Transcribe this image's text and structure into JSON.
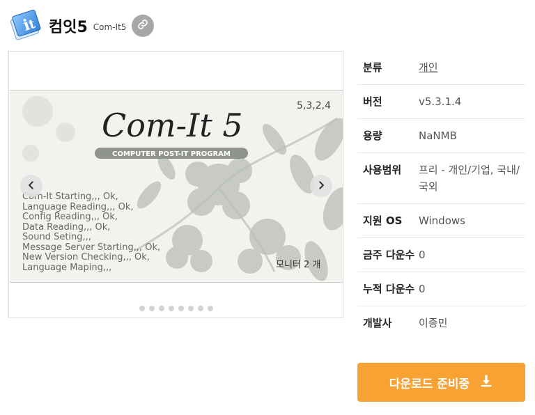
{
  "app": {
    "title": "컴잇5",
    "subtitle": "Com-It5"
  },
  "screenshot": {
    "logo": "Com-It 5",
    "version_tag": "5,3,2,4",
    "banner": "COMPUTER POST-IT PROGRAM",
    "log_lines": [
      "Com-It Starting,,, Ok,",
      "Language Reading,,, Ok,",
      "Config Reading,,, Ok,",
      "Data Reading,,, Ok,",
      "Sound Seting,,,",
      "Message Server Starting,,, Ok,",
      "New Version Checking,,, Ok,",
      "Language Maping,,,"
    ],
    "monitor_text": "모니터 2 개"
  },
  "gallery": {
    "dot_count": 8,
    "active_index": 0
  },
  "info": [
    {
      "key": "분류",
      "value": "개인",
      "link": true
    },
    {
      "key": "버전",
      "value": "v5.3.1.4"
    },
    {
      "key": "용량",
      "value": "NaNMB"
    },
    {
      "key": "사용범위",
      "value": "프리 - 개인/기업, 국내/국외"
    },
    {
      "key": "지원 OS",
      "value": "Windows"
    },
    {
      "key": "금주 다운수",
      "value": "0"
    },
    {
      "key": "누적 다운수",
      "value": "0"
    },
    {
      "key": "개발사",
      "value": "이종민"
    }
  ],
  "download": {
    "label": "다운로드 준비중"
  },
  "colors": {
    "accent": "#f7a233",
    "link_button": "#a7a7a7"
  }
}
